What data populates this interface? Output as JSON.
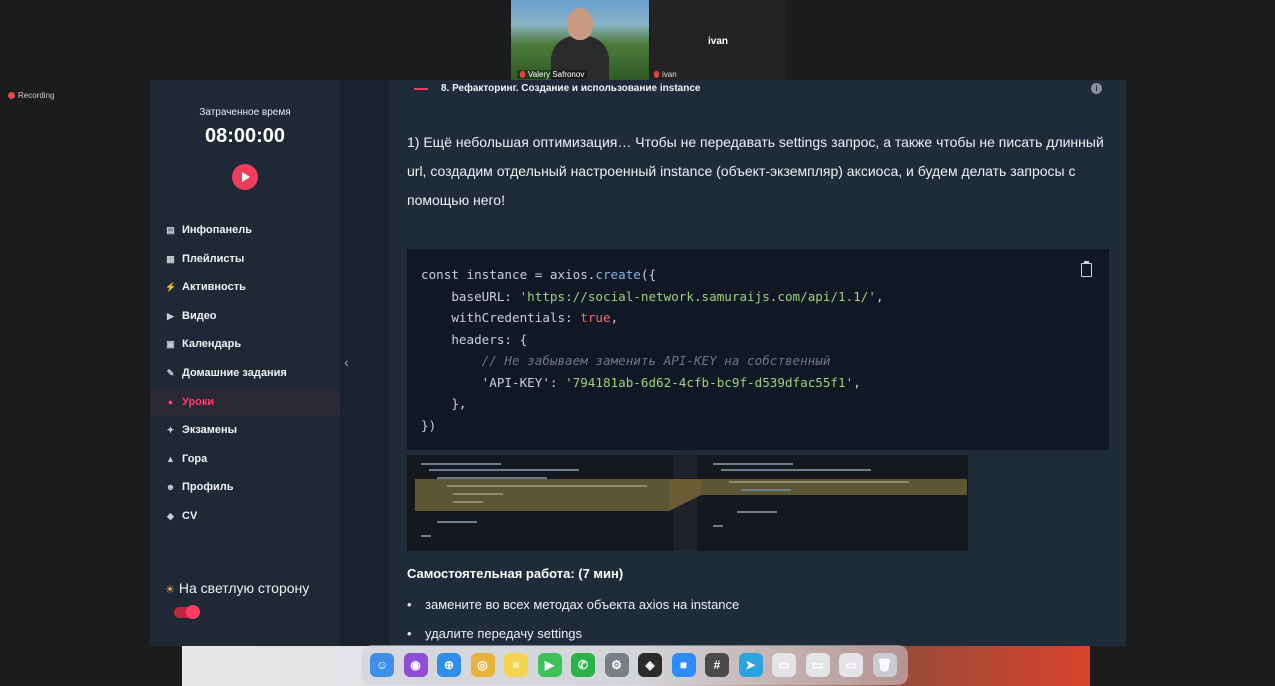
{
  "meeting": {
    "presenter_name": "Valery Safronov",
    "participant_name": "ivan",
    "participant_name_small": "ivan",
    "recording_label": "Recording"
  },
  "sidebar": {
    "timer_label": "Затраченное время",
    "timer_value": "08:00:00",
    "items": [
      {
        "label": "Инфопанель",
        "icon": "dashboard-icon",
        "glyph": "▤"
      },
      {
        "label": "Плейлисты",
        "icon": "playlist-icon",
        "glyph": "▦"
      },
      {
        "label": "Активность",
        "icon": "activity-icon",
        "glyph": "⚡"
      },
      {
        "label": "Видео",
        "icon": "video-icon",
        "glyph": "▶"
      },
      {
        "label": "Календарь",
        "icon": "calendar-icon",
        "glyph": "▣"
      },
      {
        "label": "Домашние задания",
        "icon": "homework-icon",
        "glyph": "✎"
      },
      {
        "label": "Уроки",
        "icon": "lessons-icon",
        "glyph": "●"
      },
      {
        "label": "Экзамены",
        "icon": "exams-icon",
        "glyph": "✦"
      },
      {
        "label": "Гора",
        "icon": "mountain-icon",
        "glyph": "▲"
      },
      {
        "label": "Профиль",
        "icon": "profile-icon",
        "glyph": "☻"
      },
      {
        "label": "CV",
        "icon": "cv-icon",
        "glyph": "◆"
      }
    ],
    "active_item": "Уроки",
    "theme_label": "На светлую сторону",
    "theme_toggle_on": true
  },
  "lesson": {
    "title": "8. Рефакторинг. Создание и использование instance",
    "description": "1) Ещё небольшая оптимизация… Чтобы не передавать settings запрос, а также чтобы не писать длинный url, создадим отдельный настроенный instance (объект-экземпляр) аксиоса, и будем делать запросы с помощью него!",
    "code": {
      "line1_a": "const instance = axios.",
      "line1_fn": "create",
      "line1_b": "({",
      "line2_a": "    baseURL: ",
      "line2_str": "'https://social-network.samuraijs.com/api/1.1/'",
      "line2_b": ",",
      "line3_a": "    withCredentials: ",
      "line3_bool": "true",
      "line3_b": ",",
      "line4": "    headers: {",
      "line5_cmt": "        // Не забываем заменить API-KEY на собственный",
      "line6_a": "        'API-KEY': ",
      "line6_str": "'794181ab-6d62-4cfb-bc9f-d539dfac55f1'",
      "line6_b": ",",
      "line7": "    },",
      "line8": "})"
    },
    "task_title": "Самостоятельная работа: (7 мин)",
    "tasks": [
      "замените во всех методах объекта axios на instance",
      "удалите передачу settings"
    ]
  },
  "dock": {
    "apps": [
      {
        "name": "finder-icon",
        "color": "#3d8fe8",
        "glyph": "☺"
      },
      {
        "name": "siri-icon",
        "color": "#8e4fd6",
        "glyph": "◉"
      },
      {
        "name": "safari-icon",
        "color": "#2f8fe6",
        "glyph": "⊕"
      },
      {
        "name": "chrome-icon",
        "color": "#e9b23a",
        "glyph": "◎"
      },
      {
        "name": "notes-icon",
        "color": "#f5d451",
        "glyph": "≡"
      },
      {
        "name": "facetime-icon",
        "color": "#3cc257",
        "glyph": "▶"
      },
      {
        "name": "whatsapp-icon",
        "color": "#29b34a",
        "glyph": "✆"
      },
      {
        "name": "system-settings-icon",
        "color": "#7a7f87",
        "glyph": "⚙"
      },
      {
        "name": "figma-icon",
        "color": "#2b2b2b",
        "glyph": "◈"
      },
      {
        "name": "zoom-icon",
        "color": "#2d8cff",
        "glyph": "■"
      },
      {
        "name": "calculator-icon",
        "color": "#4a4a4a",
        "glyph": "#"
      },
      {
        "name": "telegram-icon",
        "color": "#2aa3e0",
        "glyph": "➤"
      },
      {
        "name": "screenshot-thumb-1-icon",
        "color": "#e2e4e8",
        "glyph": "▭"
      },
      {
        "name": "screenshot-thumb-2-icon",
        "color": "#e2e4e8",
        "glyph": "▭"
      },
      {
        "name": "screenshot-thumb-3-icon",
        "color": "#e2e4e8",
        "glyph": "▭"
      },
      {
        "name": "trash-icon",
        "color": "#c9ccd1",
        "glyph": "🗑"
      }
    ]
  },
  "colors": {
    "accent": "#ef3e5c",
    "sidebar_bg": "#1f2835",
    "main_bg": "#202b3a",
    "code_bg": "#0f1824"
  }
}
